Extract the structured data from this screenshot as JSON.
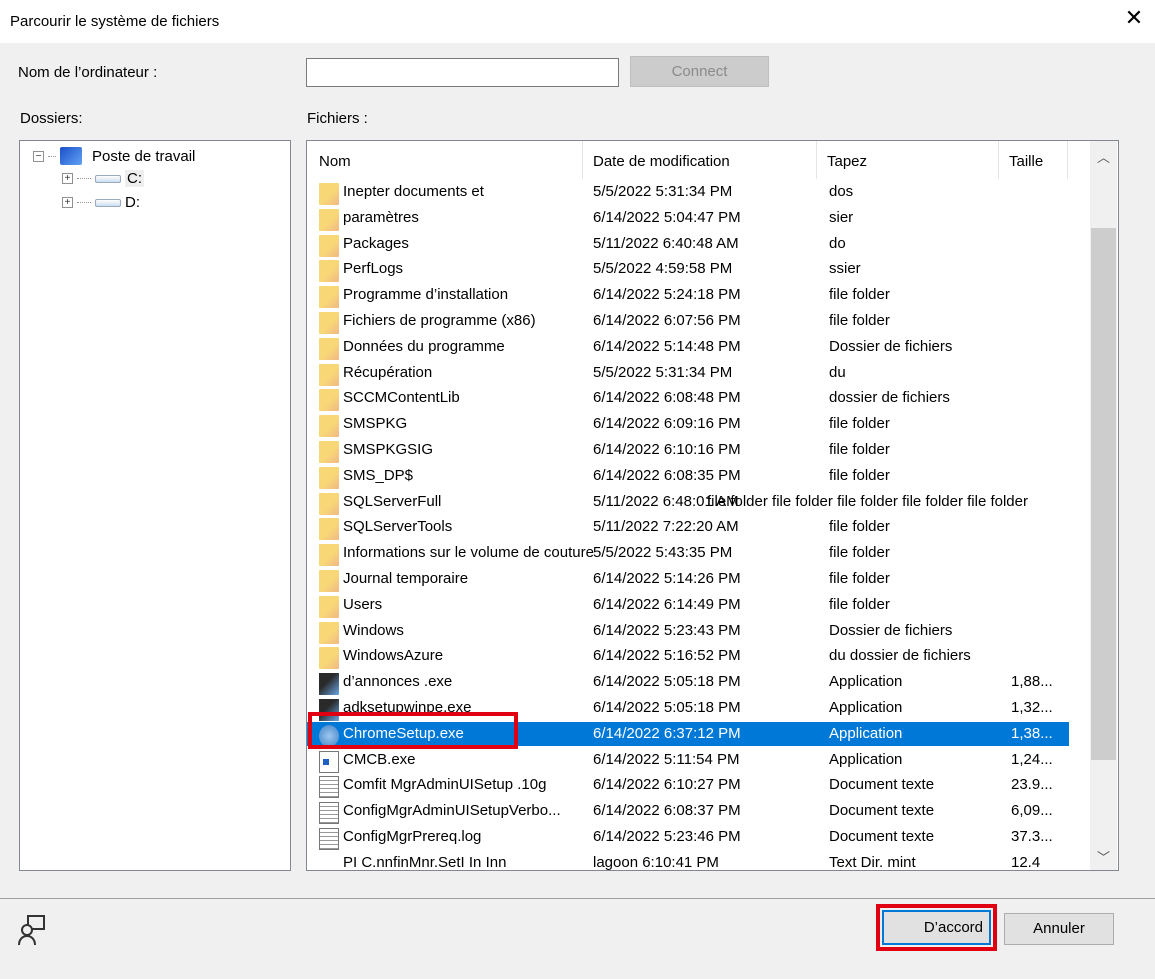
{
  "window": {
    "title": "Parcourir le système de fichiers",
    "close_icon": "close-icon"
  },
  "computer": {
    "label": "Nom de l’ordinateur :",
    "value": "",
    "connect_label": "Connect"
  },
  "folders": {
    "label": "Dossiers:",
    "tree": [
      {
        "label": "Poste de travail",
        "expanded": true
      },
      {
        "label": "C:"
      },
      {
        "label": "D:"
      }
    ]
  },
  "files": {
    "label": "Fichiers :",
    "columns": [
      "Nom",
      "Date de modification",
      "Tapez",
      "Taille"
    ],
    "rows": [
      {
        "name": "Inepter documents et",
        "date": "5/5/2022 5:31:34 PM",
        "type": "dos",
        "size": "",
        "icon": "folder"
      },
      {
        "name": "paramètres",
        "date": "6/14/2022 5:04:47 PM",
        "type": "sier",
        "size": "",
        "icon": "folder"
      },
      {
        "name": "Packages",
        "date": "5/11/2022 6:40:48 AM",
        "type": "do",
        "size": "",
        "icon": "folder"
      },
      {
        "name": "PerfLogs",
        "date": "5/5/2022 4:59:58 PM",
        "type": "ssier",
        "size": "",
        "icon": "folder"
      },
      {
        "name": "Programme d’installation",
        "date": "6/14/2022 5:24:18 PM",
        "type": "file folder",
        "size": "",
        "icon": "folder"
      },
      {
        "name": "Fichiers de programme (x86)",
        "date": "6/14/2022 6:07:56 PM",
        "type": "file folder",
        "size": "",
        "icon": "folder"
      },
      {
        "name": "Données du programme",
        "date": "6/14/2022 5:14:48 PM",
        "type": "Dossier de fichiers",
        "size": "",
        "icon": "folder"
      },
      {
        "name": "Récupération",
        "date": "5/5/2022 5:31:34 PM",
        "type": "du",
        "size": "",
        "icon": "folder"
      },
      {
        "name": "SCCMContentLib",
        "date": "6/14/2022 6:08:48 PM",
        "type": "dossier de fichiers",
        "size": "",
        "icon": "folder"
      },
      {
        "name": "SMSPKG",
        "date": "6/14/2022 6:09:16 PM",
        "type": "file folder",
        "size": "",
        "icon": "folder"
      },
      {
        "name": "SMSPKGSIG",
        "date": "6/14/2022 6:10:16 PM",
        "type": "file folder",
        "size": "",
        "icon": "folder"
      },
      {
        "name": "SMS_DP$",
        "date": "6/14/2022 6:08:35 PM",
        "type": "file folder",
        "size": "",
        "icon": "folder"
      },
      {
        "name": "SQLServerFull",
        "date": "5/11/2022 6:48:01 AM",
        "type": "file folder file folder file folder file folder file folder",
        "size": "",
        "icon": "folder"
      },
      {
        "name": "SQLServerTools",
        "date": "5/11/2022 7:22:20 AM",
        "type": "file folder",
        "size": "",
        "icon": "folder"
      },
      {
        "name": "Informations sur le volume de couture",
        "date": "5/5/2022 5:43:35 PM",
        "type": "file folder",
        "size": "",
        "icon": "folder"
      },
      {
        "name": "Journal temporaire",
        "date": "6/14/2022 5:14:26 PM",
        "type": "file folder",
        "size": "",
        "icon": "folder"
      },
      {
        "name": "Users",
        "date": "6/14/2022 6:14:49 PM",
        "type": "file folder",
        "size": "",
        "icon": "folder"
      },
      {
        "name": "Windows",
        "date": "6/14/2022 5:23:43 PM",
        "type": "Dossier de fichiers",
        "size": "",
        "icon": "folder"
      },
      {
        "name": "WindowsAzure",
        "date": "6/14/2022 5:16:52 PM",
        "type": "du dossier de fichiers",
        "size": "",
        "icon": "folder"
      },
      {
        "name": "d’annonces .exe",
        "date": "6/14/2022 5:05:18 PM",
        "type": "Application",
        "size": "1,88...",
        "icon": "app"
      },
      {
        "name": "adksetupwinpe.exe",
        "date": "6/14/2022 5:05:18 PM",
        "type": "Application",
        "size": "1,32...",
        "icon": "app"
      },
      {
        "name": "ChromeSetup.exe",
        "date": "6/14/2022 6:37:12 PM",
        "type": "Application",
        "size": "1,38...",
        "icon": "chrome",
        "selected": true
      },
      {
        "name": "CMCB.exe",
        "date": "6/14/2022 5:11:54 PM",
        "type": "Application",
        "size": "1,24...",
        "icon": "cmcb"
      },
      {
        "name": "Comfit MgrAdminUISetup .10g",
        "date": "6/14/2022 6:10:27 PM",
        "type": "Document texte",
        "size": "23.9...",
        "icon": "doc"
      },
      {
        "name": "ConfigMgrAdminUISetupVerbo...",
        "date": "6/14/2022 6:08:37 PM",
        "type": "Document texte",
        "size": "6,09...",
        "icon": "doc"
      },
      {
        "name": "ConfigMgrPrereq.log",
        "date": "6/14/2022 5:23:46 PM",
        "type": "Document texte",
        "size": "37.3...",
        "icon": "doc"
      },
      {
        "name": "PI C.nnfinMnr.SetI In Inn",
        "date": "lagoon      6:10:41 PM",
        "type": "Text Dir. mint",
        "size": "12.4",
        "icon": "none"
      }
    ]
  },
  "footer": {
    "ok_label": "D’accord",
    "cancel_label": "Annuler",
    "help_icon": "user-help-icon"
  },
  "colors": {
    "selection": "#0078d7",
    "highlight": "#e00012"
  }
}
